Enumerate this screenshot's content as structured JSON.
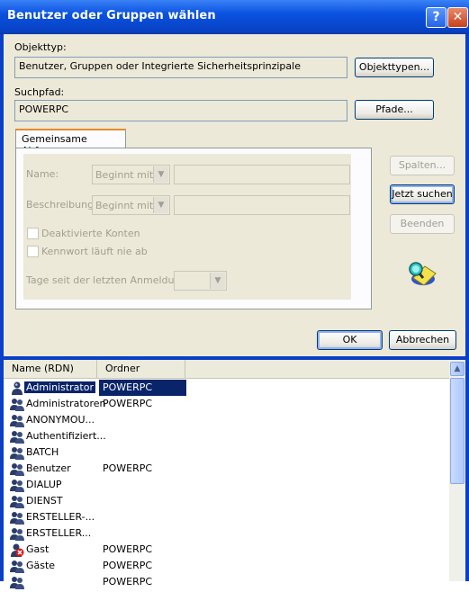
{
  "window": {
    "title": "Benutzer oder Gruppen wählen",
    "help_glyph": "?",
    "close_glyph": "✕"
  },
  "object_type": {
    "label": "Objekttyp:",
    "value": "Benutzer, Gruppen oder Integrierte Sicherheitsprinzipale",
    "button": "Objekttypen..."
  },
  "search_path": {
    "label": "Suchpfad:",
    "value": "POWERPC",
    "button": "Pfade..."
  },
  "tab": {
    "label": "Gemeinsame Abfragen",
    "name_label": "Name:",
    "name_mode": "Beginnt mit",
    "desc_label": "Beschreibung:",
    "desc_mode": "Beginnt mit",
    "disabled_accounts": "Deaktivierte Konten",
    "password_never_expires": "Kennwort läuft nie ab",
    "days_since_login": "Tage seit der letzten Anmeldung:"
  },
  "side_buttons": {
    "columns": "Spalten...",
    "search_now": "Jetzt suchen",
    "stop": "Beenden"
  },
  "footer_buttons": {
    "ok": "OK",
    "cancel": "Abbrechen"
  },
  "results": {
    "columns": [
      "Name (RDN)",
      "Ordner"
    ],
    "rows": [
      {
        "name": "Administrator",
        "folder": "POWERPC",
        "icon": "user-icon",
        "selected": true
      },
      {
        "name": "Administratoren",
        "folder": "POWERPC",
        "icon": "group-icon"
      },
      {
        "name": "ANONYMOU...",
        "folder": "",
        "icon": "group-icon"
      },
      {
        "name": "Authentifiziert...",
        "folder": "",
        "icon": "group-icon"
      },
      {
        "name": "BATCH",
        "folder": "",
        "icon": "group-icon"
      },
      {
        "name": "Benutzer",
        "folder": "POWERPC",
        "icon": "group-icon"
      },
      {
        "name": "DIALUP",
        "folder": "",
        "icon": "group-icon"
      },
      {
        "name": "DIENST",
        "folder": "",
        "icon": "group-icon"
      },
      {
        "name": "ERSTELLER-...",
        "folder": "",
        "icon": "group-icon"
      },
      {
        "name": "ERSTELLER...",
        "folder": "",
        "icon": "group-icon"
      },
      {
        "name": "Gast",
        "folder": "POWERPC",
        "icon": "disabled-user-icon"
      },
      {
        "name": "Gäste",
        "folder": "POWERPC",
        "icon": "group-icon"
      },
      {
        "name": "",
        "folder": "POWERPC",
        "icon": "group-icon"
      }
    ]
  },
  "colors": {
    "title_blue": "#0a52e0",
    "selection": "#0a246a",
    "dialog_bg": "#ece9d8"
  }
}
